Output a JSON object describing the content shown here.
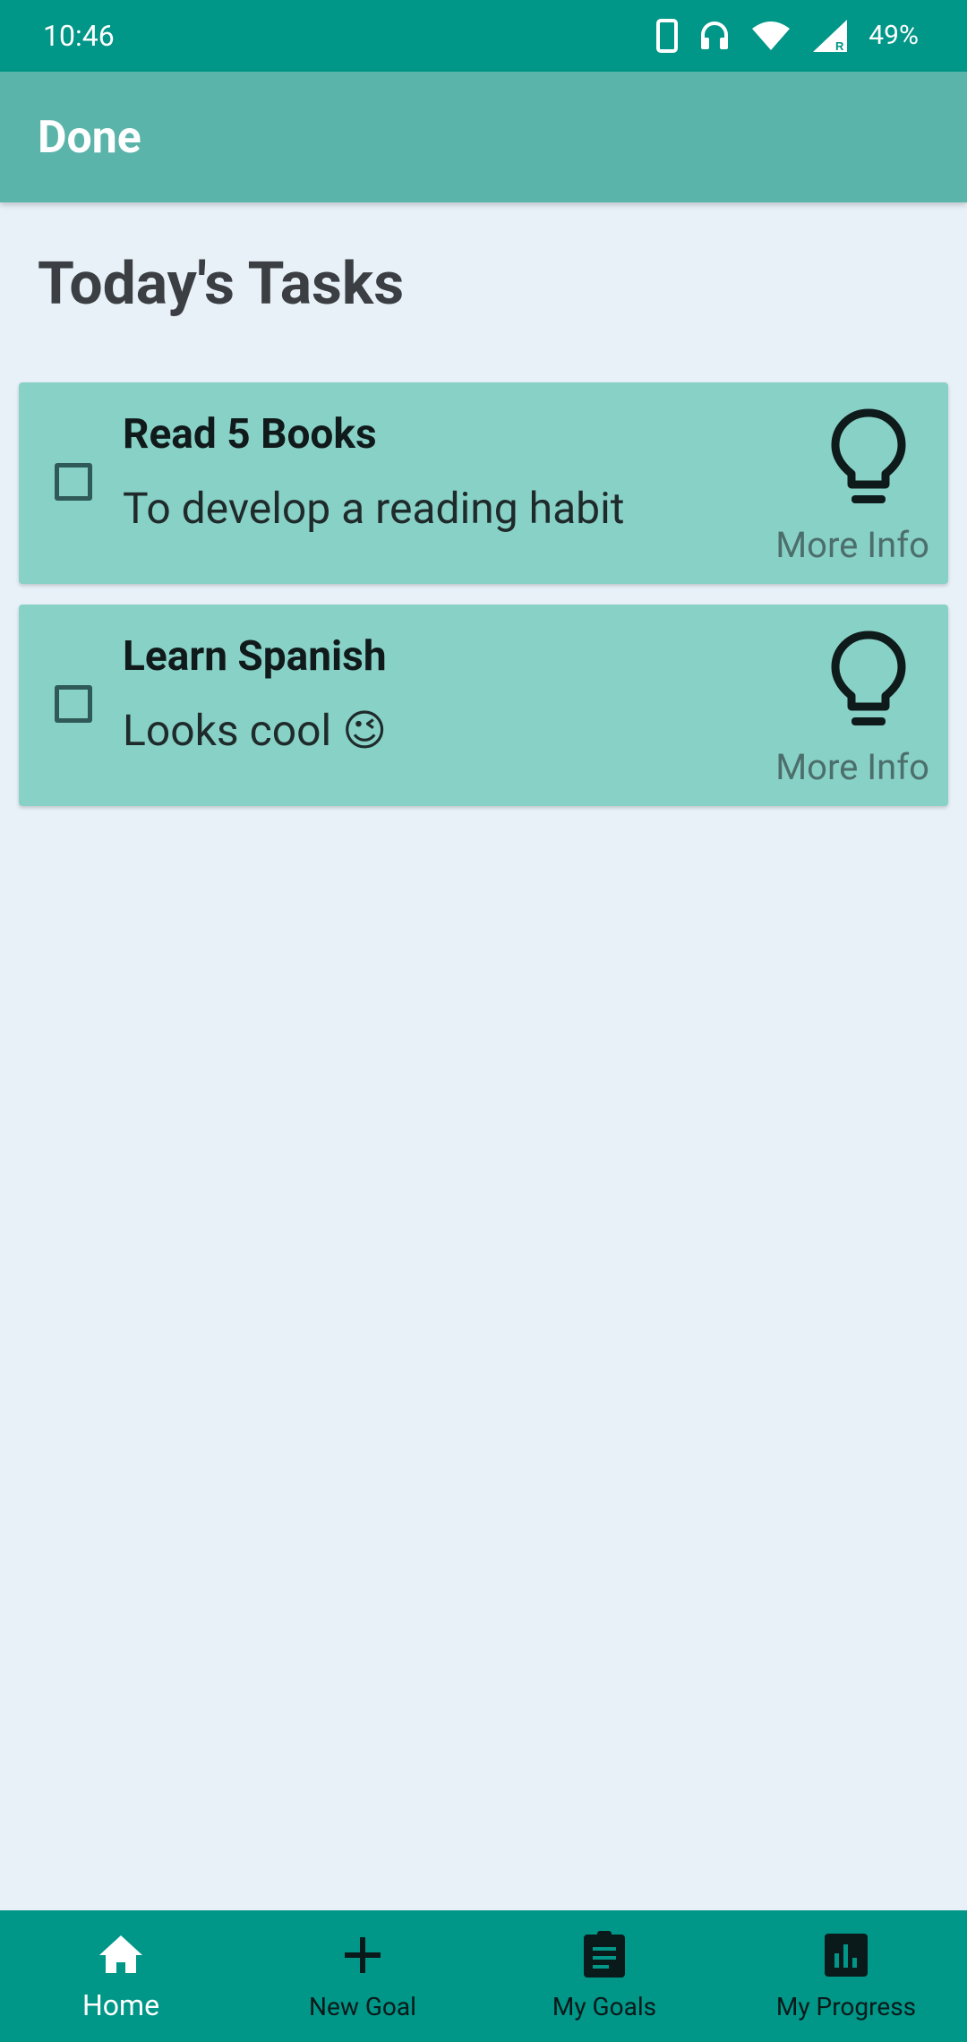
{
  "status_bar": {
    "time": "10:46",
    "battery": "49%",
    "icons": [
      "phone-icon",
      "headset-icon",
      "wifi-icon",
      "signal-icon"
    ]
  },
  "app_bar": {
    "title": "Done"
  },
  "page": {
    "title": "Today's Tasks"
  },
  "tasks": [
    {
      "title": "Read 5 Books",
      "description": "To develop a reading habit",
      "checked": false,
      "more_info_label": "More Info",
      "icon": "lightbulb-icon"
    },
    {
      "title": "Learn Spanish",
      "description": "Looks cool 😉",
      "checked": false,
      "more_info_label": "More Info",
      "icon": "lightbulb-icon"
    }
  ],
  "bottom_nav": {
    "items": [
      {
        "label": "Home",
        "icon": "home-icon",
        "active": true
      },
      {
        "label": "New Goal",
        "icon": "plus-icon",
        "active": false
      },
      {
        "label": "My Goals",
        "icon": "clipboard-icon",
        "active": false
      },
      {
        "label": "My Progress",
        "icon": "bar-chart-icon",
        "active": false
      }
    ]
  },
  "colors": {
    "status_bar": "#009688",
    "app_bar": "#5bb4aa",
    "background": "#e8f1f8",
    "card": "#88d1c7",
    "bottom_nav": "#009688",
    "nav_active_text": "#ffffff"
  }
}
